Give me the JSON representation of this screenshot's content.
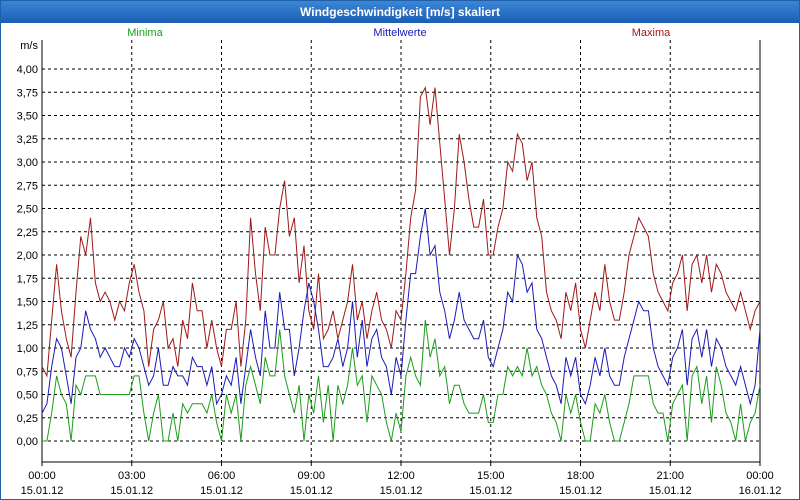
{
  "window": {
    "title": "Windgeschwindigkeit [m/s] skaliert"
  },
  "colors": {
    "min": "#1a9e1a",
    "avg": "#1a1ab8",
    "max": "#a01818",
    "grid": "#000000",
    "titlebar": "#2a6fc4"
  },
  "chart_data": {
    "type": "line",
    "title": "Windgeschwindigkeit [m/s] skaliert",
    "ylabel": "m/s",
    "ylim": [
      0,
      4.2
    ],
    "grid": true,
    "legend": "top",
    "yticks": [
      "0,00",
      "0,25",
      "0,50",
      "0,75",
      "1,00",
      "1,25",
      "1,50",
      "1,75",
      "2,00",
      "2,25",
      "2,50",
      "2,75",
      "3,00",
      "3,25",
      "3,50",
      "3,75",
      "4,00"
    ],
    "xticks": [
      {
        "time": "00:00",
        "date": "15.01.12"
      },
      {
        "time": "03:00",
        "date": "15.01.12"
      },
      {
        "time": "06:00",
        "date": "15.01.12"
      },
      {
        "time": "09:00",
        "date": "15.01.12"
      },
      {
        "time": "12:00",
        "date": "15.01.12"
      },
      {
        "time": "15:00",
        "date": "15.01.12"
      },
      {
        "time": "18:00",
        "date": "15.01.12"
      },
      {
        "time": "21:00",
        "date": "15.01.12"
      },
      {
        "time": "00:00",
        "date": "16.01.12"
      }
    ],
    "series": [
      {
        "name": "Minima",
        "key": "min",
        "values": [
          0.0,
          0.0,
          0.3,
          0.7,
          0.5,
          0.4,
          0.0,
          0.6,
          0.5,
          0.7,
          0.7,
          0.7,
          0.5,
          0.5,
          0.5,
          0.5,
          0.5,
          0.5,
          0.5,
          0.7,
          0.7,
          0.3,
          0.0,
          0.3,
          0.5,
          0.0,
          0.0,
          0.3,
          0.0,
          0.4,
          0.3,
          0.4,
          0.4,
          0.4,
          0.3,
          0.5,
          0.2,
          0.0,
          0.5,
          0.3,
          0.5,
          0.0,
          0.6,
          0.8,
          0.6,
          0.4,
          0.9,
          0.7,
          0.7,
          1.2,
          0.7,
          0.5,
          0.3,
          0.6,
          0.0,
          0.5,
          0.3,
          0.7,
          0.2,
          0.6,
          0.0,
          0.6,
          0.4,
          0.6,
          1.0,
          0.6,
          0.7,
          0.2,
          0.7,
          0.6,
          0.5,
          0.2,
          0.0,
          0.3,
          0.1,
          0.7,
          0.9,
          0.7,
          0.6,
          1.3,
          0.9,
          1.1,
          0.7,
          0.8,
          0.4,
          0.6,
          0.6,
          0.4,
          0.3,
          0.3,
          0.3,
          0.5,
          0.2,
          0.2,
          0.5,
          0.5,
          0.8,
          0.7,
          0.8,
          0.7,
          1.0,
          0.7,
          0.8,
          0.6,
          0.5,
          0.3,
          0.2,
          0.0,
          0.5,
          0.3,
          0.5,
          0.2,
          0.0,
          0.0,
          0.4,
          0.3,
          0.5,
          0.2,
          0.0,
          0.0,
          0.2,
          0.4,
          0.7,
          0.7,
          0.7,
          0.7,
          0.4,
          0.3,
          0.3,
          0.0,
          0.4,
          0.5,
          0.6,
          0.0,
          0.7,
          0.8,
          0.4,
          0.7,
          0.2,
          0.8,
          0.6,
          0.3,
          0.2,
          0.0,
          0.4,
          0.0,
          0.2,
          0.3,
          0.6
        ]
      },
      {
        "name": "Mittelwerte",
        "key": "avg",
        "values": [
          0.3,
          0.4,
          0.8,
          1.1,
          1.0,
          0.7,
          0.4,
          0.9,
          1.0,
          1.4,
          1.2,
          1.1,
          0.9,
          1.0,
          0.9,
          0.8,
          0.8,
          1.0,
          0.9,
          1.1,
          1.0,
          0.8,
          0.6,
          0.7,
          1.0,
          0.6,
          0.6,
          0.8,
          0.7,
          0.7,
          0.6,
          0.9,
          0.8,
          0.8,
          0.6,
          0.8,
          0.4,
          0.5,
          0.7,
          0.6,
          0.9,
          0.4,
          0.8,
          1.2,
          0.9,
          0.7,
          1.4,
          1.0,
          1.0,
          1.6,
          1.2,
          1.2,
          0.7,
          1.0,
          1.4,
          1.7,
          1.5,
          1.2,
          0.8,
          0.8,
          0.9,
          1.1,
          0.8,
          1.0,
          1.5,
          0.9,
          1.3,
          0.8,
          1.1,
          1.2,
          0.9,
          0.8,
          0.5,
          0.9,
          0.7,
          1.3,
          1.8,
          1.8,
          2.2,
          2.5,
          2.0,
          2.1,
          1.6,
          1.4,
          1.1,
          1.3,
          1.6,
          1.3,
          1.2,
          1.1,
          1.1,
          1.3,
          0.9,
          0.8,
          1.0,
          1.2,
          1.6,
          1.5,
          2.0,
          1.9,
          1.6,
          1.7,
          1.2,
          1.1,
          0.9,
          0.7,
          0.6,
          0.4,
          0.9,
          0.7,
          0.9,
          0.5,
          0.4,
          0.6,
          0.9,
          0.7,
          1.0,
          0.7,
          0.6,
          0.6,
          0.9,
          1.1,
          1.3,
          1.5,
          1.4,
          1.4,
          1.0,
          0.8,
          0.7,
          0.6,
          0.9,
          1.0,
          1.2,
          0.6,
          1.1,
          1.2,
          0.9,
          1.2,
          0.8,
          1.1,
          1.0,
          0.8,
          0.7,
          0.6,
          0.8,
          0.6,
          0.4,
          0.6,
          1.2
        ]
      },
      {
        "name": "Maxima",
        "key": "max",
        "values": [
          0.8,
          0.7,
          1.3,
          1.9,
          1.4,
          1.1,
          0.9,
          1.6,
          2.2,
          2.0,
          2.4,
          1.7,
          1.5,
          1.6,
          1.5,
          1.3,
          1.5,
          1.4,
          1.7,
          1.9,
          1.6,
          1.4,
          0.8,
          1.2,
          1.3,
          1.5,
          1.0,
          1.1,
          0.8,
          1.3,
          1.1,
          1.7,
          1.4,
          1.4,
          1.0,
          1.3,
          1.0,
          0.8,
          1.2,
          1.2,
          1.5,
          0.8,
          1.3,
          2.4,
          1.8,
          1.4,
          2.3,
          2.0,
          2.0,
          2.5,
          2.8,
          2.2,
          2.4,
          1.7,
          2.1,
          1.4,
          1.2,
          1.8,
          1.1,
          1.2,
          1.4,
          1.1,
          1.3,
          1.5,
          1.9,
          1.3,
          1.5,
          1.1,
          1.4,
          1.6,
          1.3,
          1.2,
          1.0,
          1.4,
          1.3,
          1.8,
          2.4,
          2.7,
          3.7,
          3.8,
          3.4,
          3.8,
          3.2,
          2.6,
          2.0,
          2.5,
          3.3,
          3.0,
          2.6,
          2.3,
          2.3,
          2.6,
          2.0,
          2.0,
          2.3,
          2.5,
          3.0,
          2.9,
          3.3,
          3.2,
          2.8,
          3.0,
          2.4,
          2.2,
          1.6,
          1.4,
          1.3,
          1.1,
          1.6,
          1.4,
          1.7,
          1.2,
          1.0,
          1.3,
          1.6,
          1.4,
          1.9,
          1.5,
          1.3,
          1.3,
          1.6,
          2.0,
          2.2,
          2.4,
          2.3,
          2.2,
          1.8,
          1.6,
          1.5,
          1.4,
          1.7,
          1.8,
          2.0,
          1.4,
          1.9,
          2.0,
          1.7,
          2.0,
          1.6,
          1.9,
          1.8,
          1.6,
          1.5,
          1.4,
          1.6,
          1.4,
          1.2,
          1.4,
          1.5
        ]
      }
    ]
  }
}
